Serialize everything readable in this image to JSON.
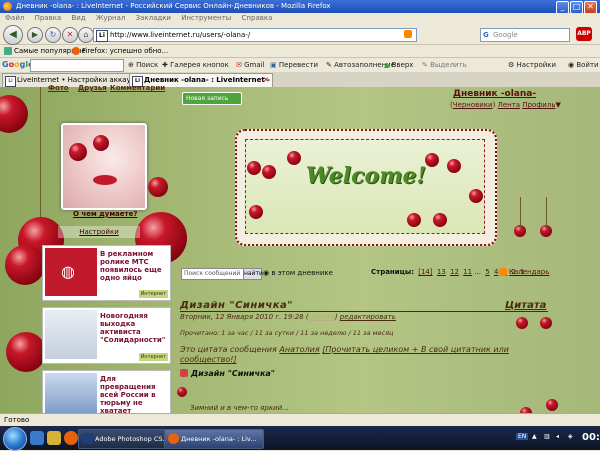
{
  "window": {
    "title": "Дневник -olana- : LiveInternet - Российский Сервис Онлайн-Дневников - Mozilla Firefox",
    "min": "_",
    "max": "□",
    "close": "✕"
  },
  "menu": [
    "Файл",
    "Правка",
    "Вид",
    "Журнал",
    "Закладки",
    "Инструменты",
    "Справка"
  ],
  "nav": {
    "url": "http://www.liveinternet.ru/users/-olana-/",
    "search_placeholder": "Google",
    "abp": "ABP"
  },
  "bookmarks": {
    "items": [
      "Самые популярные",
      "Firefox: успешно обно..."
    ]
  },
  "gtoolbar": {
    "logo": "Google",
    "items": [
      "Поиск",
      "Галерея кнопок",
      "Gmail",
      "Перевести",
      "Автозаполнение",
      "Вверх",
      "Выделить",
      "Настройки",
      "Войти"
    ]
  },
  "tabs": [
    {
      "label": "LiveInternet • Настройки аккаунта • ...",
      "active": false
    },
    {
      "label": "Дневник -olana- : LiveInternet - ...",
      "active": true
    }
  ],
  "page": {
    "top_links": [
      "Фото",
      "Друзья",
      "Комментарии"
    ],
    "think_link": "О чем думаете?",
    "settings_link": "Настройки",
    "ads": [
      {
        "text": "В рекламном ролике МТС появилось еще одно яйцо",
        "tag": "Интернет"
      },
      {
        "text": "Новогодняя выходка активиста \"Солидарности\"",
        "tag": "Интернет"
      },
      {
        "text": "Для превращения всей России в тюрьму не хватает браслетов",
        "tag": ""
      }
    ],
    "new_post": "Новая запись",
    "blog_title": "Дневник -olana-",
    "blog_links": [
      "Черновики",
      "Лента",
      "Профиль"
    ],
    "welcome": "Welcome!",
    "search_msgs": "Поиск сообщений",
    "find_btn": "найти",
    "in_diary": "в этом дневнике",
    "pages_label": "Страницы:",
    "pages": [
      "[14]",
      "13",
      "12",
      "11",
      "...",
      "5",
      "4",
      "3",
      "2",
      "1"
    ],
    "calendar": "Календарь",
    "post": {
      "title": "Дизайн \"Синичка\"",
      "quote_label": "Цитата",
      "date": "Вторник, 12 Января 2010 г. 19:28",
      "date_link": "ссылка",
      "date_edit": "редактировать",
      "stats": "Прочитано: 1 за час / 11 за сутки / 11 за неделю / 11 за месяц",
      "quote_prefix": "Это цитата сообщения",
      "quote_author": "Анатолия",
      "quote_read": "[Прочитать целиком + В свой цитатник или сообщество!]",
      "subtitle": "Дизайн \"Синичка\"",
      "snippet": "Зимний и в чем-то яркий..."
    }
  },
  "status": "Готово",
  "taskbar": {
    "tasks": [
      {
        "label": "Adobe Photoshop CS...",
        "active": false
      },
      {
        "label": "Дневник -olana- : Liv...",
        "active": true
      }
    ],
    "lang": "EN",
    "clock": "00:12"
  }
}
